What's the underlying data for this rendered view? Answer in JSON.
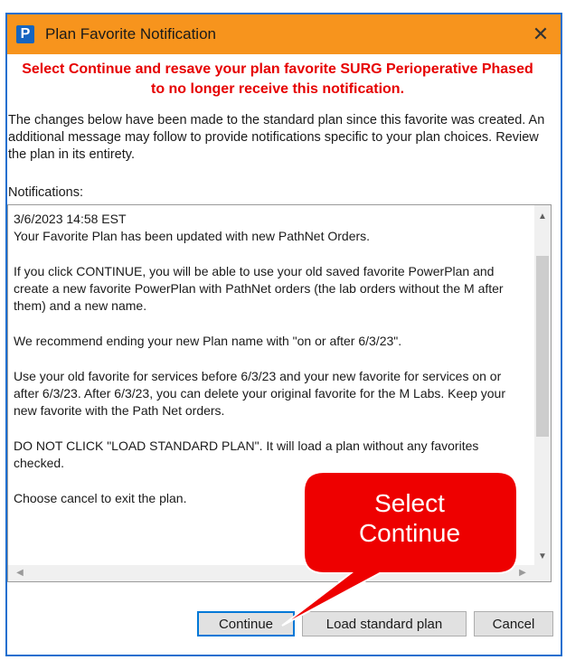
{
  "window": {
    "title": "Plan Favorite Notification",
    "app_icon_letter": "P",
    "close_glyph": "✕"
  },
  "warning": {
    "line1": "Select Continue and resave your plan favorite SURG Perioperative Phased",
    "line2": "to no longer receive this notification."
  },
  "description": "The changes below have been made to the standard plan since this favorite was created. An additional message may follow to provide notifications specific to your plan choices. Review the plan in its entirety.",
  "notifications_label": "Notifications:",
  "notifications": {
    "timestamp": "3/6/2023 14:58 EST",
    "p1": "Your Favorite Plan has been updated with new PathNet Orders.",
    "p2": "If you click CONTINUE, you will be able to use your old saved favorite PowerPlan and create a new favorite PowerPlan with PathNet orders (the lab orders without the M after them) and a new name.",
    "p3": "We recommend ending your new Plan name with \"on or after 6/3/23\".",
    "p4": "Use your old favorite for services before 6/3/23 and your new favorite for services on or after 6/3/23.  After 6/3/23, you can delete your original favorite for the M Labs.  Keep your new favorite with the Path Net orders.",
    "p5": "DO NOT CLICK \"LOAD STANDARD PLAN\".  It will load a plan without any favorites checked.",
    "p6": "Choose cancel to exit the plan."
  },
  "buttons": {
    "continue": "Continue",
    "load_standard": "Load standard plan",
    "cancel": "Cancel"
  },
  "callout": {
    "line1": "Select",
    "line2": "Continue"
  },
  "colors": {
    "titlebar": "#f7941d",
    "window_border": "#1f6fcf",
    "warning_text": "#e60000",
    "callout_fill": "#ee0000",
    "default_button_border": "#0078d7"
  },
  "icons": {
    "scroll_up": "▲",
    "scroll_down": "▼",
    "scroll_left": "◀",
    "scroll_right": "▶"
  }
}
